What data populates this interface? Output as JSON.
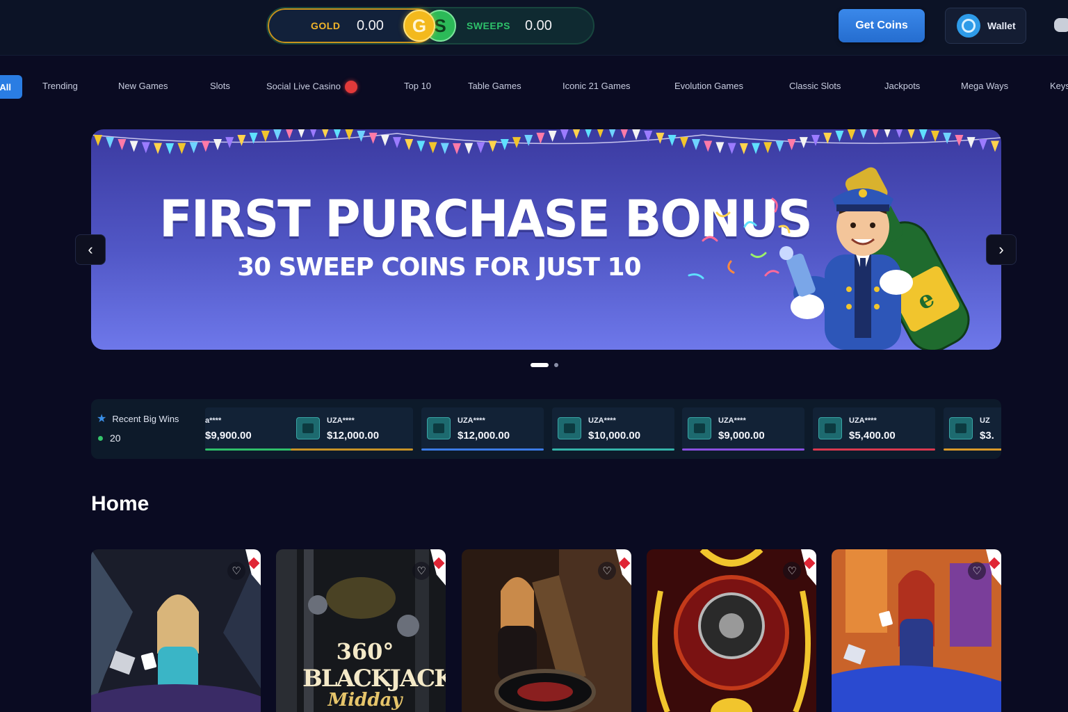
{
  "topbar": {
    "gold_label": "GOLD",
    "gold_value": "0.00",
    "gold_coin": "G",
    "sweeps_coin": "S",
    "sweeps_label": "SWEEPS",
    "sweeps_value": "0.00",
    "get_coins_label": "Get Coins",
    "wallet_label": "Wallet"
  },
  "nav": {
    "active": "All",
    "items": [
      "Trending",
      "New Games",
      "Slots",
      "Social Live Casino",
      "Top 10",
      "Table Games",
      "Iconic 21 Games",
      "Evolution Games",
      "Classic Slots",
      "Jackpots",
      "Mega Ways",
      "Keys"
    ]
  },
  "banner": {
    "title": "FIRST PURCHASE BONUS",
    "subtitle": "30 SWEEP COINS FOR JUST 10",
    "prev_icon": "‹",
    "next_icon": "›"
  },
  "wins": {
    "title": "Recent Big Wins",
    "count": "20",
    "items": [
      {
        "user": "a****",
        "amount": "$9,900.00",
        "bar": "#2fbf6a"
      },
      {
        "user": "UZA****",
        "amount": "$12,000.00",
        "bar": "#c79227"
      },
      {
        "user": "UZA****",
        "amount": "$12,000.00",
        "bar": "#3c7be6"
      },
      {
        "user": "UZA****",
        "amount": "$10,000.00",
        "bar": "#34b3a9"
      },
      {
        "user": "UZA****",
        "amount": "$9,000.00",
        "bar": "#8a4fe0"
      },
      {
        "user": "UZA****",
        "amount": "$5,400.00",
        "bar": "#d9384f"
      },
      {
        "user": "UZ",
        "amount": "$3.",
        "bar": "#d99a2a"
      }
    ]
  },
  "home": {
    "title": "Home",
    "games": [
      {
        "name": "blackjack-dealer-1"
      },
      {
        "name": "360 Blackjack Midday",
        "n": "360°",
        "b": "BLACKJACK",
        "m": "Midday"
      },
      {
        "name": "roulette-dealer"
      },
      {
        "name": "roulette-wheel"
      },
      {
        "name": "blackjack-dealer-2"
      }
    ]
  }
}
